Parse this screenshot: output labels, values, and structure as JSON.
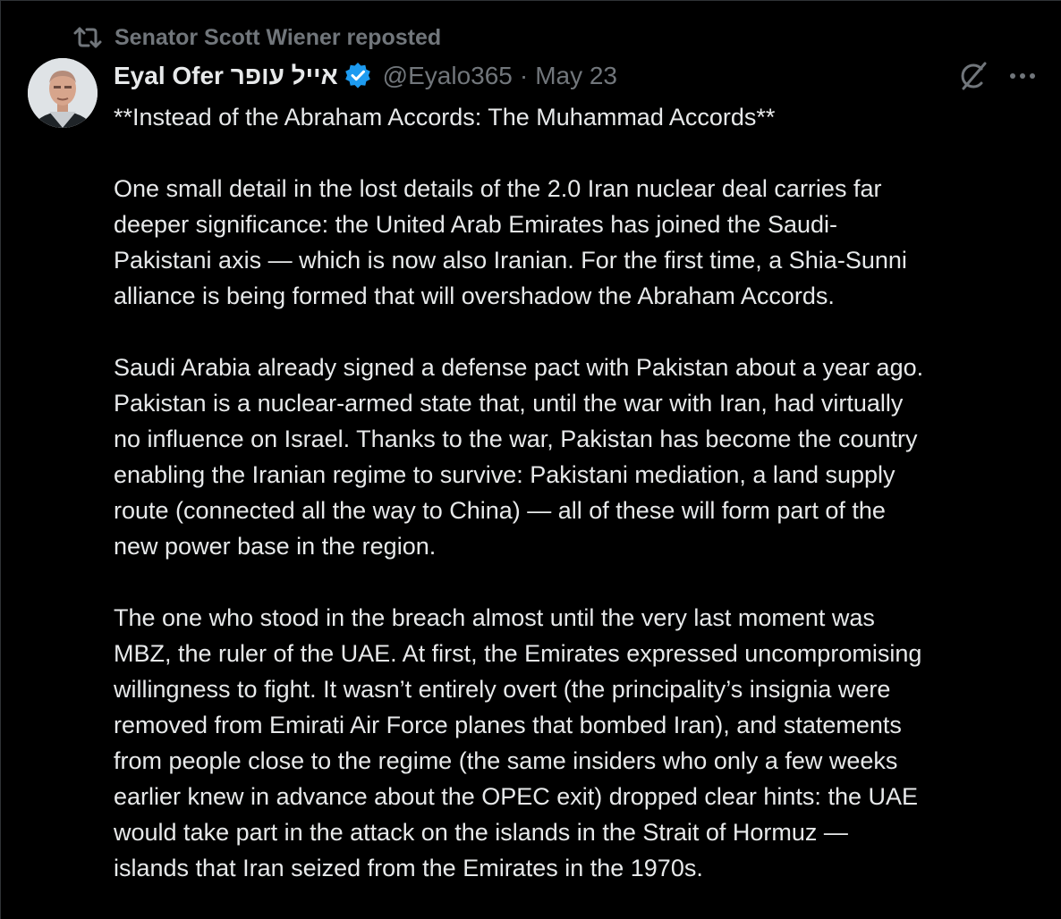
{
  "repost": {
    "icon": "repost-icon",
    "text": "Senator Scott Wiener reposted"
  },
  "author": {
    "avatar": "avatar-photo",
    "name": "Eyal Ofer אייל עופר",
    "verified_icon": "verified-badge-icon",
    "handle": "@Eyalo365",
    "separator": "·",
    "date": "May 23"
  },
  "actions": {
    "grok_icon": "grok-icon",
    "more_icon": "more-options-icon"
  },
  "colors": {
    "background": "#000000",
    "text": "#e7e9ea",
    "muted": "#71767b",
    "verified": "#1d9bf0"
  },
  "tweet": {
    "title": "**Instead of the Abraham Accords: The Muhammad Accords**",
    "p1_l1": "One small detail in the lost details of the 2.0 Iran nuclear deal carries far",
    "p1_l2": "deeper significance: the United Arab Emirates has joined the Saudi-",
    "p1_l3": "Pakistani axis — which is now also Iranian. For the first time, a Shia-Sunni",
    "p1_l4": "alliance is being formed that will overshadow the Abraham Accords.",
    "p2_l1": "Saudi Arabia already signed a defense pact with Pakistan about a year ago.",
    "p2_l2": "Pakistan is a nuclear-armed state that, until the war with Iran, had virtually",
    "p2_l3": "no influence on Israel. Thanks to the war, Pakistan has become the country",
    "p2_l4": "enabling the Iranian regime to survive: Pakistani mediation, a land supply",
    "p2_l5": "route (connected all the way to China) — all of these will form part of the",
    "p2_l6": "new power base in the region.",
    "p3_l1": "The one who stood in the breach almost until the very last moment was",
    "p3_l2": "MBZ, the ruler of the UAE. At first, the Emirates expressed uncompromising",
    "p3_l3": "willingness to fight. It wasn’t entirely overt (the principality’s insignia were",
    "p3_l4": "removed from Emirati Air Force planes that bombed Iran), and statements",
    "p3_l5": "from people close to the regime (the same insiders who only a few weeks",
    "p3_l6": "earlier knew in advance about the OPEC exit) dropped clear hints: the UAE",
    "p3_l7": "would take part in the attack on the islands in the Strait of Hormuz —",
    "p3_l8": "islands that Iran seized from the Emirates in the 1970s."
  }
}
